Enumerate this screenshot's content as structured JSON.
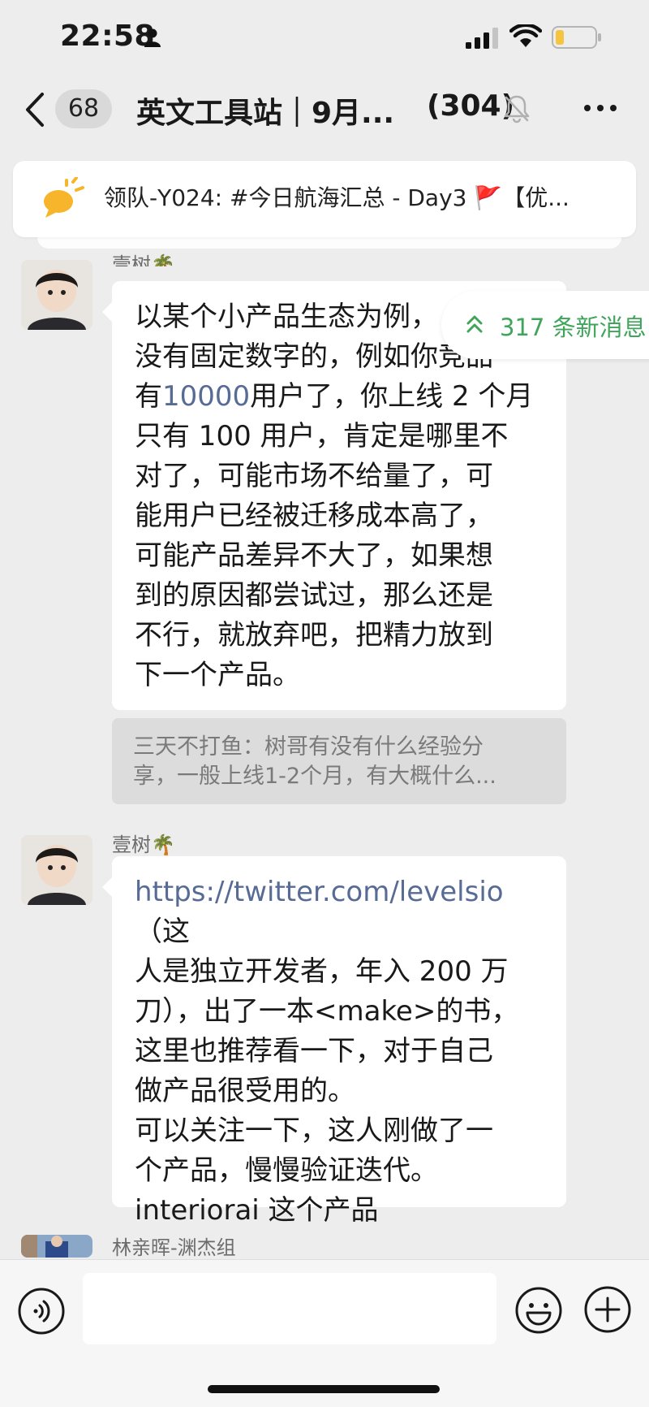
{
  "status_bar": {
    "time": "22:58",
    "icons": [
      "person-icon",
      "signal-icon",
      "wifi-icon",
      "battery-icon"
    ]
  },
  "nav": {
    "unread_count": "68",
    "title": "英文工具站｜9月...",
    "member_count": "(304)",
    "icons": [
      "back-icon",
      "mute-bell-icon",
      "more-icon"
    ]
  },
  "pinned": {
    "text": "领队-Y024: #今日航海汇总 - Day3 🚩【优...",
    "icon": "announcement-icon"
  },
  "new_messages": {
    "label": "317 条新消息",
    "color": "#3fa55b"
  },
  "messages": [
    {
      "sender": "壹树🌴",
      "lines": [
        {
          "parts": [
            {
              "text": "以某个小产品生态为例，",
              "style": "plain"
            }
          ]
        },
        {
          "parts": [
            {
              "text": "没有固定数字的，例如你竞品",
              "style": "plain"
            }
          ]
        },
        {
          "parts": [
            {
              "text": "有",
              "style": "plain"
            },
            {
              "text": "10000",
              "style": "link"
            },
            {
              "text": "用户了，你上线 2 个月",
              "style": "plain"
            }
          ]
        },
        {
          "parts": [
            {
              "text": "只有 100 用户，肯定是哪里不",
              "style": "plain"
            }
          ]
        },
        {
          "parts": [
            {
              "text": "对了，可能市场不给量了，可",
              "style": "plain"
            }
          ]
        },
        {
          "parts": [
            {
              "text": "能用户已经被迁移成本高了，",
              "style": "plain"
            }
          ]
        },
        {
          "parts": [
            {
              "text": "可能产品差异不大了，如果想",
              "style": "plain"
            }
          ]
        },
        {
          "parts": [
            {
              "text": "到的原因都尝试过，那么还是",
              "style": "plain"
            }
          ]
        },
        {
          "parts": [
            {
              "text": "不行，就放弃吧，把精力放到",
              "style": "plain"
            }
          ]
        },
        {
          "parts": [
            {
              "text": "下一个产品。",
              "style": "plain"
            }
          ]
        }
      ],
      "quote": {
        "line1": "三天不打鱼：树哥有没有什么经验分",
        "line2": "享，一般上线1-2个月，有大概什么..."
      }
    },
    {
      "sender": "壹树🌴",
      "lines": [
        {
          "parts": [
            {
              "text": "https://twitter.com/levelsio",
              "style": "link"
            },
            {
              "text": "（这",
              "style": "plain"
            }
          ]
        },
        {
          "parts": [
            {
              "text": "人是独立开发者，年入 200 万",
              "style": "plain"
            }
          ]
        },
        {
          "parts": [
            {
              "text": "刀），出了一本<make>的书，",
              "style": "plain"
            }
          ]
        },
        {
          "parts": [
            {
              "text": "这里也推荐看一下，对于自己",
              "style": "plain"
            }
          ]
        },
        {
          "parts": [
            {
              "text": "做产品很受用的。",
              "style": "plain"
            }
          ]
        },
        {
          "parts": [
            {
              "text": "可以关注一下，这人刚做了一",
              "style": "plain"
            }
          ]
        },
        {
          "parts": [
            {
              "text": "个产品，慢慢验证迭代。",
              "style": "plain"
            }
          ]
        },
        {
          "parts": [
            {
              "text": "interiorai 这个产品",
              "style": "plain"
            }
          ]
        }
      ]
    },
    {
      "sender": "林亲晖-渊杰组",
      "lines": []
    }
  ],
  "input_bar": {
    "placeholder": "",
    "icons": [
      "voice-icon",
      "emoji-icon",
      "plus-icon"
    ]
  },
  "colors": {
    "background": "#ededed",
    "bubble": "#ffffff",
    "link": "#576b95",
    "quote_bg": "#dcdcdc"
  }
}
